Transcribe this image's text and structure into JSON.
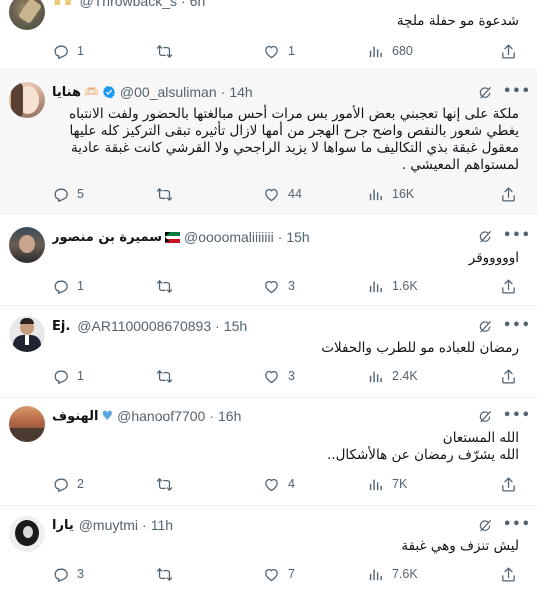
{
  "tweets": [
    {
      "name": "",
      "handle": "@Throwback_s",
      "time": "6h",
      "text": "شدعوة مو حفلة ملچة",
      "replies": "1",
      "reposts": "",
      "likes": "1",
      "views": "680"
    },
    {
      "name": "هنايا",
      "handle": "@00_alsuliman",
      "time": "14h",
      "text": "ملكة على إنها تعجبني بعض الأمور بس مرات أحس مبالغتها بالحضور ولفت الانتباه يغطي شعور بالنقص واضح جرح الهجر من أمها لازال تأثيره تبقى التركيز كله عليها معقول غبقة بذي التكاليف ما سواها لا يزيد الراجحي ولا القرشي كانت غبقة عادية لمستواهم المعيشي .",
      "replies": "5",
      "reposts": "",
      "likes": "44",
      "views": "16K"
    },
    {
      "name": "سميرة بن منصور",
      "handle": "@oooomaliiiiiii",
      "time": "15h",
      "text": "اوووووقر",
      "replies": "1",
      "reposts": "",
      "likes": "3",
      "views": "1.6K"
    },
    {
      "name": "Ej.",
      "handle": "@AR1100008670893",
      "time": "15h",
      "text": "رمضان للعباده مو للطرب والحفلات",
      "replies": "1",
      "reposts": "",
      "likes": "3",
      "views": "2.4K"
    },
    {
      "name": "الهنوف",
      "handle": "@hanoof7700",
      "time": "16h",
      "text_lines": [
        "الله المستعان",
        "الله يشرّف رمضان عن هالأشكال.."
      ],
      "replies": "2",
      "reposts": "",
      "likes": "4",
      "views": "7K"
    },
    {
      "name": "يارا",
      "handle": "@muytmi",
      "time": "11h",
      "text": "ليش تنزف وهي غبقة",
      "replies": "3",
      "reposts": "",
      "likes": "7",
      "views": "7.6K"
    }
  ],
  "separator": "·",
  "more_glyph": "•••",
  "colors": {
    "verified": "#1d9bf0",
    "secondary_text": "#536471",
    "highlight_bg": "#f7f7f7",
    "heart_emoji": "#5aa9e6"
  },
  "icons": [
    "reply-icon",
    "repost-icon",
    "like-icon",
    "views-icon",
    "share-icon",
    "grok-icon",
    "more-icon",
    "verified-icon"
  ]
}
